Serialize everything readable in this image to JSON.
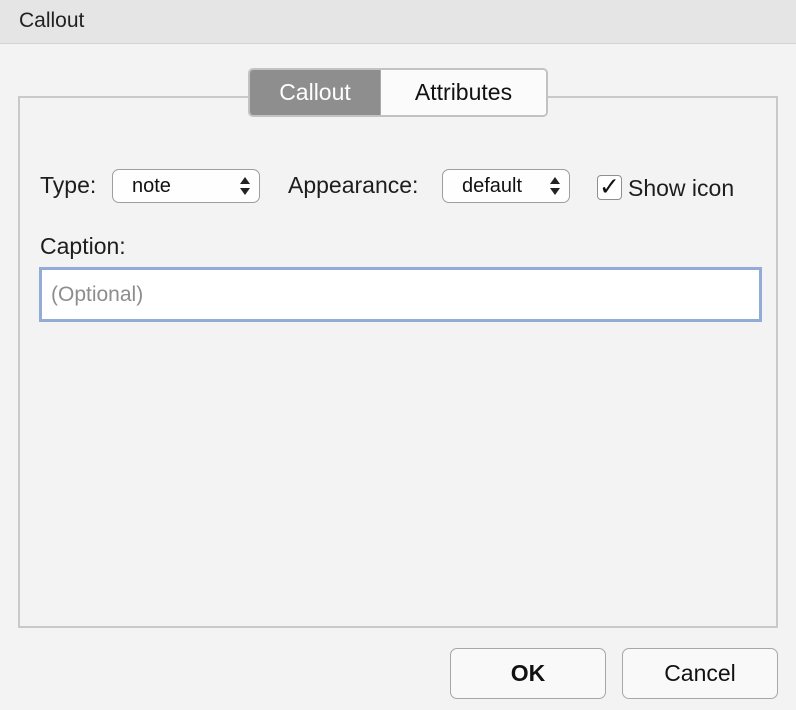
{
  "window": {
    "title": "Callout"
  },
  "tabs": [
    {
      "label": "Callout",
      "selected": true
    },
    {
      "label": "Attributes",
      "selected": false
    }
  ],
  "form": {
    "type_label": "Type:",
    "type_value": "note",
    "appearance_label": "Appearance:",
    "appearance_value": "default",
    "show_icon_label": "Show icon",
    "show_icon_checked": true,
    "caption_label": "Caption:",
    "caption_value": "",
    "caption_placeholder": "(Optional)"
  },
  "buttons": {
    "ok_label": "OK",
    "cancel_label": "Cancel"
  },
  "colors": {
    "selected_tab_bg": "#8e8e8e",
    "focus_border": "#92acd6"
  },
  "icons": {
    "checkbox": "checkmark-icon",
    "select_arrows": "up-down-chevron-icon"
  }
}
